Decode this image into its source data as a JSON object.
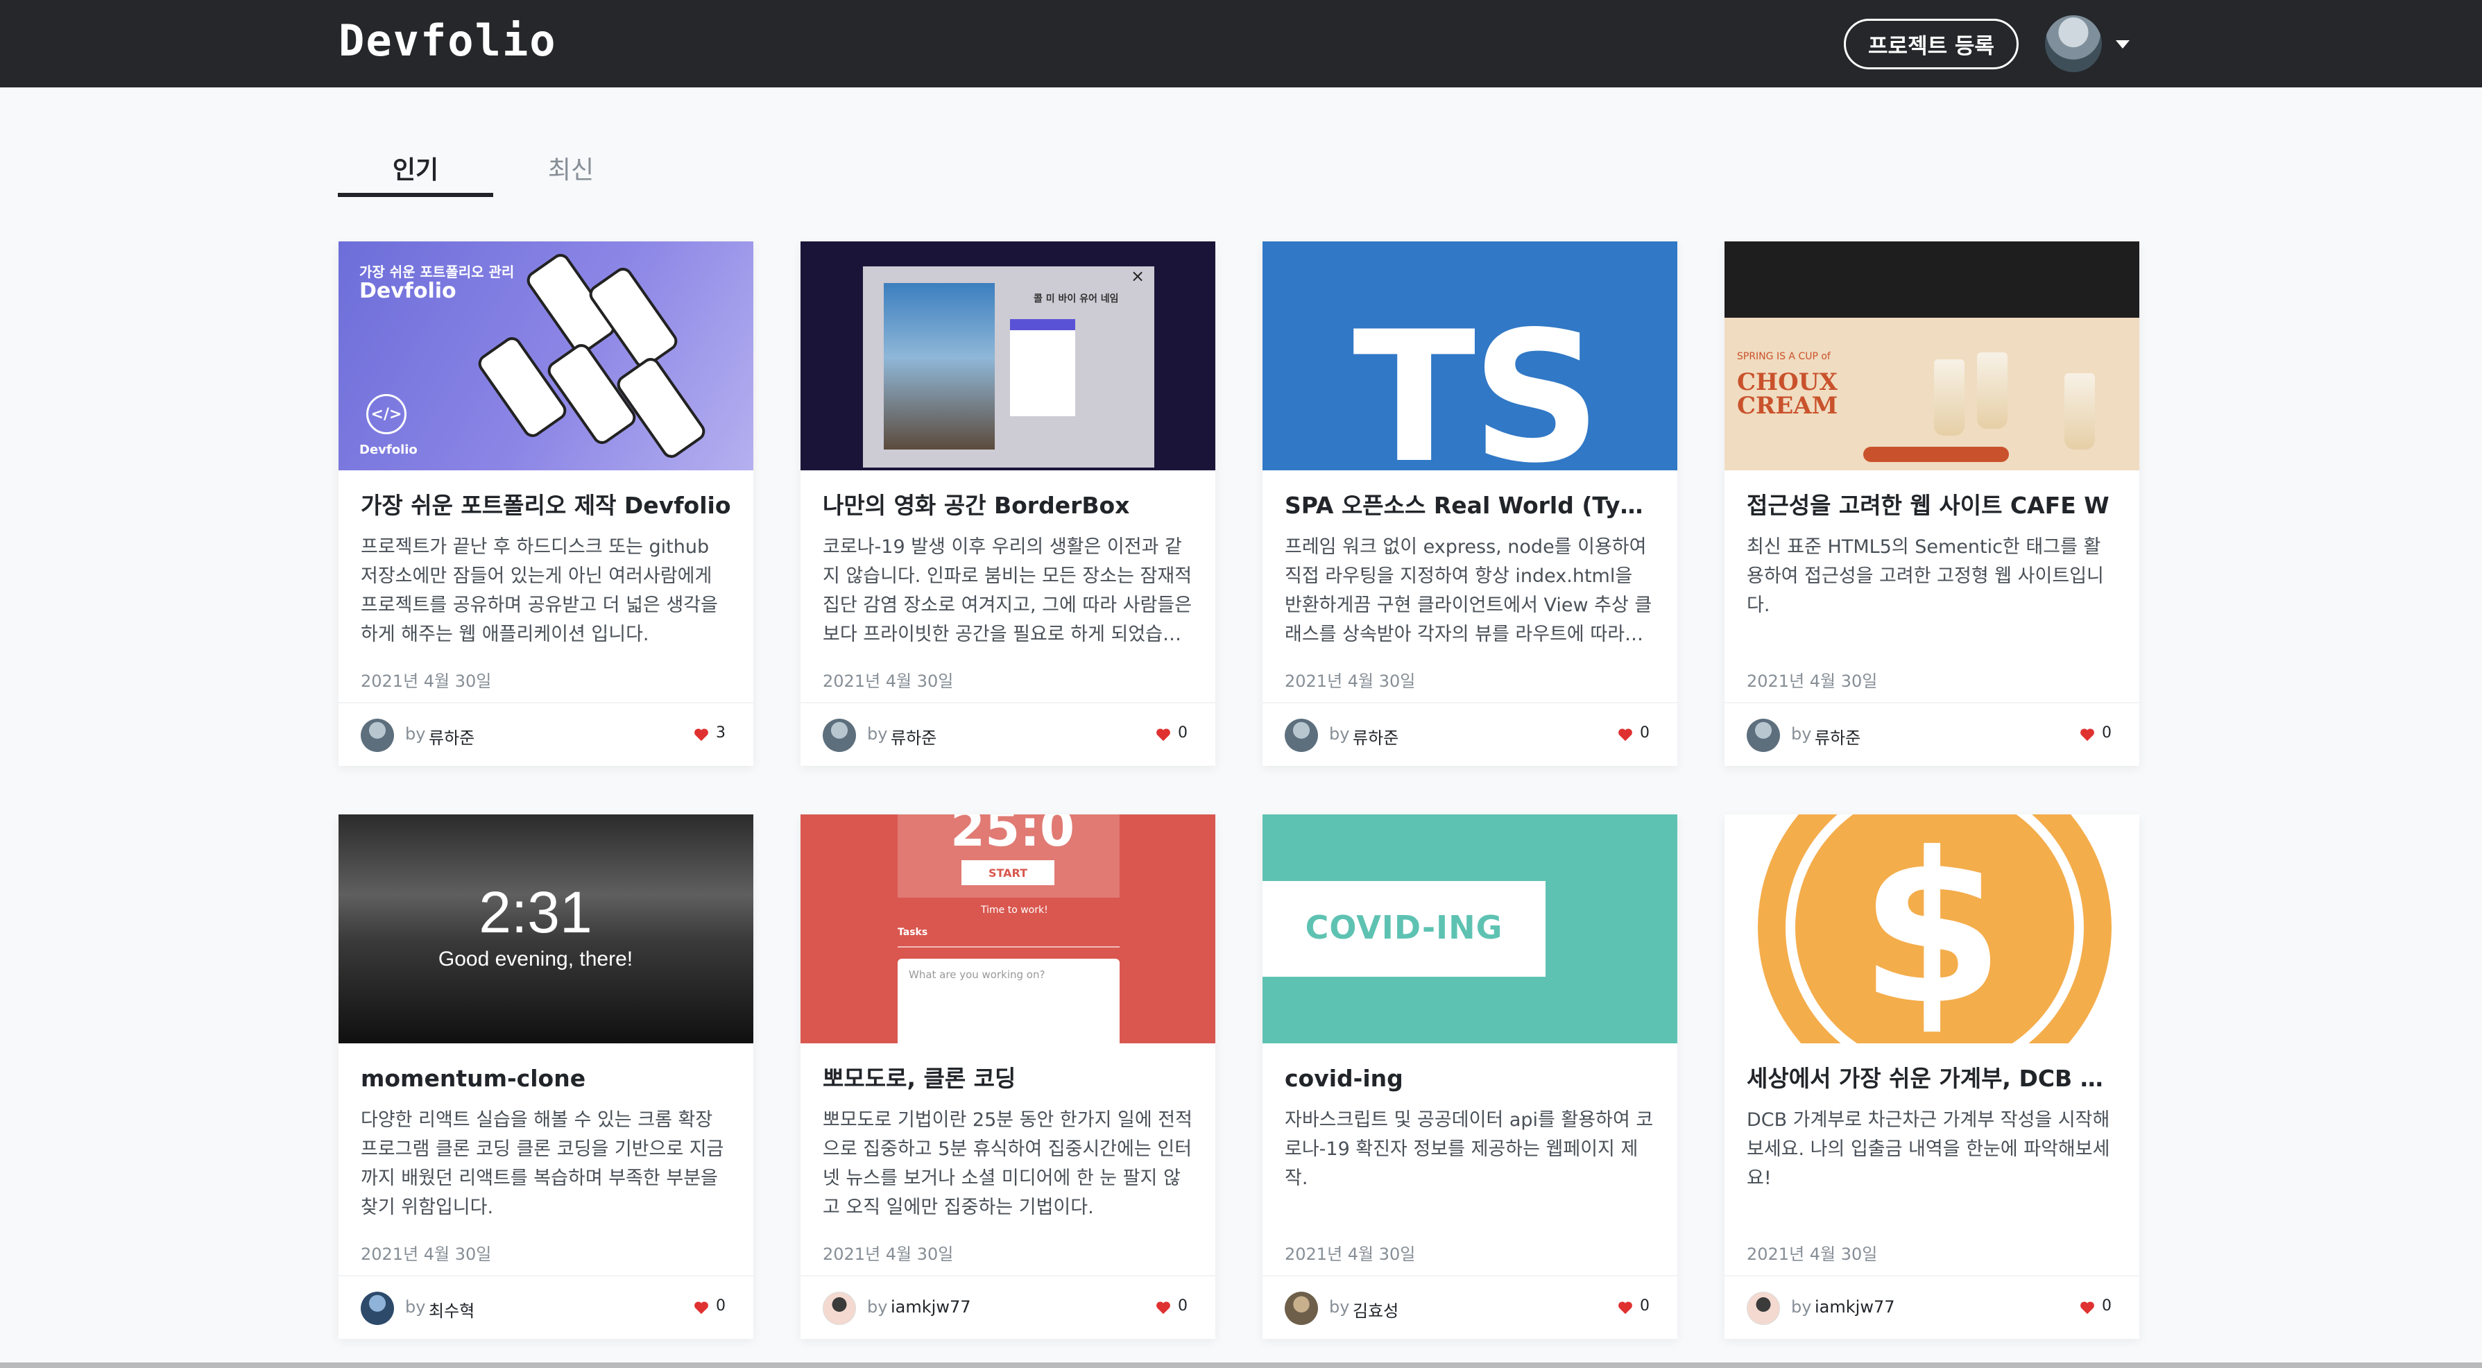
{
  "app": {
    "logo": "Devfolio"
  },
  "header": {
    "register_label": "프로젝트 등록"
  },
  "tabs": [
    {
      "label": "인기",
      "active": true
    },
    {
      "label": "최신",
      "active": false
    }
  ],
  "colors": {
    "header_bg": "#25272a",
    "heart": "#e03131",
    "page_bg": "#f8f9fa"
  },
  "thumbnails": {
    "devfolio": {
      "line1": "가장 쉬운 포트폴리오 관리",
      "line2": "Devfolio",
      "badge": "</>",
      "mark": "Devfolio"
    },
    "borderbox": {
      "modal_title": "콜 미 바이 유어 네임",
      "close": "×"
    },
    "typescript": {
      "text": "TS"
    },
    "cafe": {
      "small": "SPRING IS A CUP of",
      "brand": "CHOUX CREAM"
    },
    "momentum": {
      "time": "2:31",
      "greeting": "Good evening, there!"
    },
    "pomodoro": {
      "time": "25:0",
      "start": "START",
      "subtitle": "Time to work!",
      "tasks": "Tasks",
      "placeholder": "What are you working on?"
    },
    "covid": {
      "word": "COVID-ING"
    },
    "dollar": {
      "sign": "$"
    }
  },
  "cards": [
    {
      "title": "가장 쉬운 포트폴리오 제작 Devfolio",
      "description": "프로젝트가 끝난 후 하드디스크 또는 github 저장소에만 잠들어 있는게 아닌 여러사람에게 프로젝트를 공유하며 공유받고 더 넓은 생각을 하게 해주는 웹 애플리케이션 입니다.",
      "date": "2021년 4월 30일",
      "by": "by",
      "author": "류하준",
      "likes": "3"
    },
    {
      "title": "나만의 영화 공간 BorderBox",
      "description": "코로나-19 발생 이후 우리의 생활은 이전과 같지 않습니다. 인파로 붐비는 모든 장소는 잠재적 집단 감염 장소로 여겨지고, 그에 따라 사람들은 보다 프라이빗한 공간을 필요로 하게 되었습니다.",
      "date": "2021년 4월 30일",
      "by": "by",
      "author": "류하준",
      "likes": "0"
    },
    {
      "title": "SPA 오픈소스 Real World (Typescript)",
      "description": "프레임 워크 없이 express, node를 이용하여 직접 라우팅을 지정하여 항상 index.html을 반환하게끔 구현 클라이언트에서 View 추상 클래스를 상속받아 각자의 뷰를 라우트에 따라 C…",
      "date": "2021년 4월 30일",
      "by": "by",
      "author": "류하준",
      "likes": "0"
    },
    {
      "title": "접근성을 고려한 웹 사이트 CAFE W",
      "description": "최신 표준 HTML5의 Sementic한 태그를 활용하여 접근성을 고려한 고정형 웹 사이트입니다.",
      "date": "2021년 4월 30일",
      "by": "by",
      "author": "류하준",
      "likes": "0"
    },
    {
      "title": "momentum-clone",
      "description": "다양한 리액트 실습을 해볼 수 있는 크롬 확장 프로그램 클론 코딩 클론 코딩을 기반으로 지금까지 배웠던 리액트를 복습하며 부족한 부분을 찾기 위함입니다.",
      "date": "2021년 4월 30일",
      "by": "by",
      "author": "최수혁",
      "likes": "0"
    },
    {
      "title": "뽀모도로, 클론 코딩",
      "description": "뽀모도로 기법이란 25분 동안 한가지 일에 전적으로 집중하고 5분 휴식하여 집중시간에는 인터넷 뉴스를 보거나 소셜 미디어에 한 눈 팔지 않고 오직 일에만 집중하는 기법이다.",
      "date": "2021년 4월 30일",
      "by": "by",
      "author": "iamkjw77",
      "likes": "0"
    },
    {
      "title": "covid-ing",
      "description": "자바스크립트 및 공공데이터 api를 활용하여 코로나-19 확진자 정보를 제공하는 웹페이지 제작.",
      "date": "2021년 4월 30일",
      "by": "by",
      "author": "김효성",
      "likes": "0"
    },
    {
      "title": "세상에서 가장 쉬운 가계부, DCB 머니",
      "description": "DCB 가계부로 차근차근 가계부 작성을 시작해보세요. 나의 입출금 내역을 한눈에 파악해보세요!",
      "date": "2021년 4월 30일",
      "by": "by",
      "author": "iamkjw77",
      "likes": "0"
    }
  ]
}
